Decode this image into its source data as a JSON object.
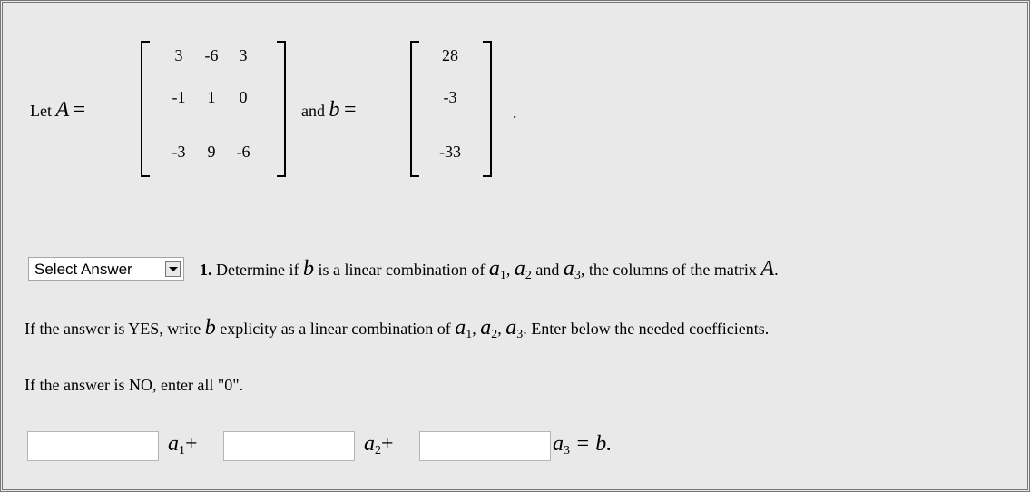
{
  "problem": {
    "let_label": "Let",
    "A_symbol": "A",
    "equals": "=",
    "and_label": "and",
    "b_symbol": "b",
    "period": ".",
    "matrix_A": [
      [
        "3",
        "-6",
        "3"
      ],
      [
        "-1",
        "1",
        "0"
      ],
      [
        "-3",
        "9",
        "-6"
      ]
    ],
    "vector_b": [
      "28",
      "-3",
      "-33"
    ]
  },
  "question": {
    "select": {
      "value": "Select Answer"
    },
    "number": "1.",
    "text1": "Determine if",
    "b": "b",
    "text2": "is a linear combination of",
    "a": "a",
    "s1": "1",
    "s2": "2",
    "s3": "3",
    "comma": ",",
    "and": "and",
    "text3": ", the columns of the matrix",
    "A": "A",
    "end": "."
  },
  "instructions": {
    "yes_1": "If the answer is YES, write",
    "yes_2": "explicity as a linear combination of",
    "yes_3": ". Enter below the needed coefficients.",
    "no": "If the answer is NO, enter all \"0\"."
  },
  "equation": {
    "coef1": "",
    "coef2": "",
    "coef3": "",
    "plus": "+",
    "equals_b": "= b."
  }
}
